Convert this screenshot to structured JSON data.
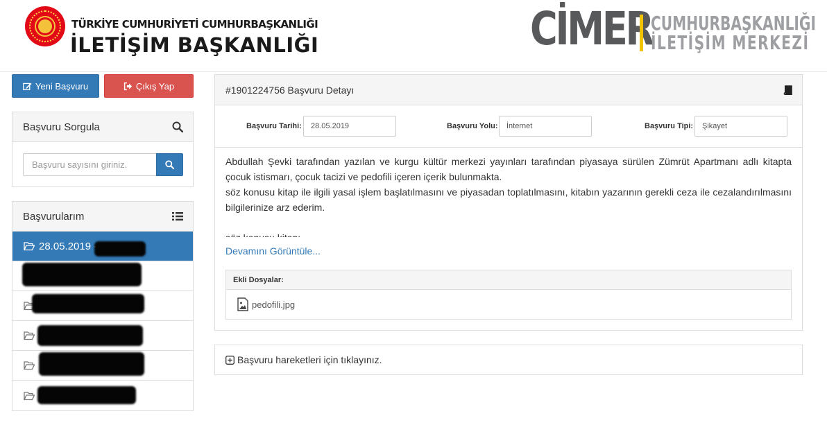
{
  "header": {
    "org_small": "TÜRKİYE CUMHURİYETİ CUMHURBAŞKANLIĞI",
    "org_big": "İLETİŞİM BAŞKANLIĞI",
    "cimer": "CİMER",
    "cimer_sub1": "CUMHURBAŞKANLIĞI",
    "cimer_sub2": "İLETİŞİM MERKEZİ"
  },
  "actions": {
    "new_label": "Yeni Başvuru",
    "exit_label": "Çıkış Yap"
  },
  "query": {
    "title": "Başvuru Sorgula",
    "placeholder": "Başvuru sayısını giriniz."
  },
  "applications": {
    "title": "Başvurularım",
    "items": [
      {
        "label": "28.05.2019 - #",
        "active": true
      },
      {
        "label": "",
        "active": false
      },
      {
        "label": "",
        "active": false
      },
      {
        "label": "",
        "active": false
      },
      {
        "label": "",
        "active": false
      },
      {
        "label": "",
        "active": false
      }
    ]
  },
  "detail": {
    "title": "#1901224756 Başvuru Detayı",
    "date_label": "Başvuru Tarihi:",
    "date_value": "28.05.2019",
    "channel_label": "Başvuru Yolu:",
    "channel_value": "İnternet",
    "type_label": "Başvuru Tipi:",
    "type_value": "Şikayet",
    "paragraph1": "Abdullah Şevki tarafından yazılan ve kurgu kültür merkezi yayınları tarafından piyasaya sürülen Zümrüt Apartmanı adlı kitapta çocuk istismarı, çocuk tacizi ve pedofili içeren içerik bulunmakta.",
    "paragraph2": "söz konusu kitap ile ilgili yasal işlem başlatılmasını ve piyasadan toplatılmasını, kitabın yazarının gerekli ceza ile cezalandırılmasını bilgilerinize arz ederim.",
    "paragraph3": "söz konusu kitap:",
    "more_link": "Devamını Görüntüle...",
    "files_title": "Ekli Dosyalar:",
    "file_name": "pedofili.jpg"
  },
  "moves": {
    "label": "Başvuru hareketleri için tıklayınız."
  },
  "colors": {
    "primary": "#337ab7",
    "danger": "#d9534f",
    "brand_red": "#e30a17",
    "cimer_yellow": "#f2c300",
    "cimer_gray": "#58595b"
  }
}
